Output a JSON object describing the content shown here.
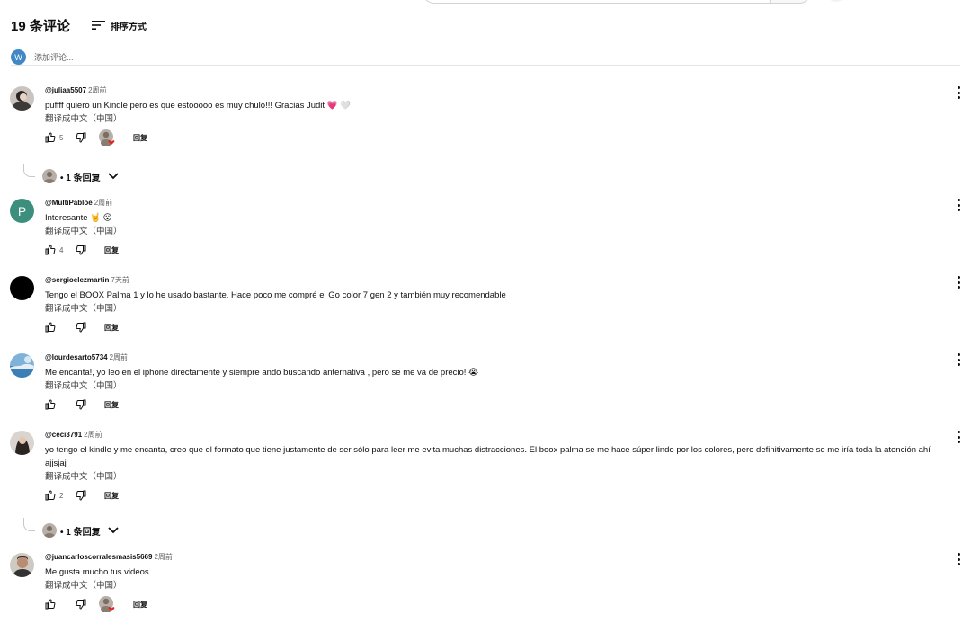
{
  "header": {
    "count_label": "19 条评论",
    "sort_label": "排序方式"
  },
  "add_comment": {
    "avatar_letter": "W",
    "placeholder": "添加评论..."
  },
  "translate_label": "翻译成中文（中国）",
  "reply_label": "回复",
  "comments": [
    {
      "handle": "@juliaa5507",
      "time": "2周前",
      "text": "puffff quiero un Kindle pero es que estooooo es muy chulo!!! Gracias Judit 💗 🤍",
      "likes": "5",
      "creator_heart": true,
      "replies_label": "• 1 条回复"
    },
    {
      "handle": "@MultiPabloe",
      "time": "2周前",
      "text": "Interesante 🤘 😮",
      "likes": "4",
      "avatar_letter": "P"
    },
    {
      "handle": "@sergioelezmartin",
      "time": "7天前",
      "text": "Tengo el BOOX Palma 1 y lo he usado bastante. Hace poco me compré el Go color 7 gen 2 y también muy recomendable",
      "likes": ""
    },
    {
      "handle": "@lourdesarto5734",
      "time": "2周前",
      "text": "Me encanta!, yo leo en el iphone directamente y siempre ando buscando anternativa , pero se me va de precio! 😭",
      "likes": ""
    },
    {
      "handle": "@ceci3791",
      "time": "2周前",
      "text": "yo tengo el kindle y me encanta, creo que el formato que tiene justamente de ser sólo para leer me evita muchas distracciones. El boox palma se me hace súper lindo por los colores, pero definitivamente se me iría toda la atención ahí ajjsjaj",
      "likes": "2",
      "replies_label": "• 1 条回复"
    },
    {
      "handle": "@juancarloscorralesmasis5669",
      "time": "2周前",
      "text": "Me gusta mucho tus videos",
      "likes": "",
      "creator_heart": true
    }
  ],
  "colors": {
    "accent_blue": "#3f88c5",
    "green_avatar": "#3c8f7c",
    "heart_red": "#e62117"
  },
  "icons": [
    "sort-icon",
    "thumbs-up-icon",
    "thumbs-down-icon",
    "more-vert-icon",
    "chevron-down-icon",
    "heart-icon"
  ]
}
